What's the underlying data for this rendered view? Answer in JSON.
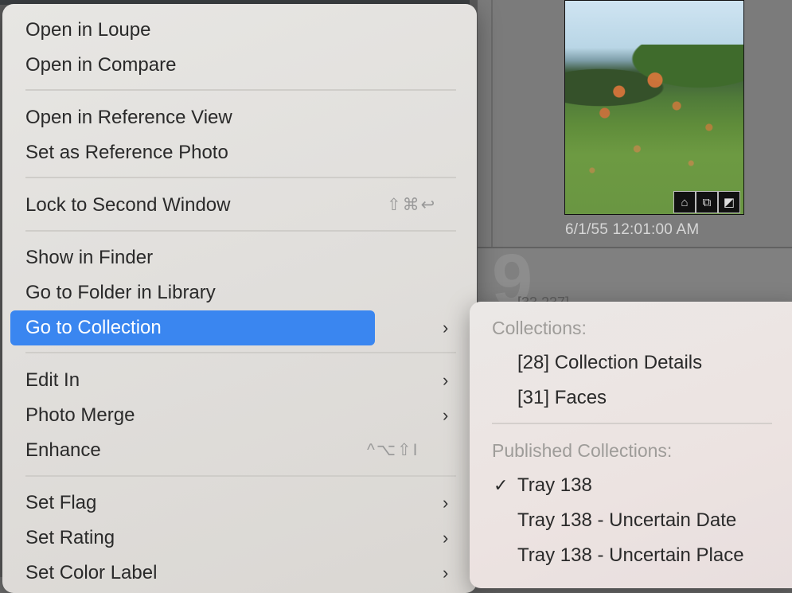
{
  "background": {
    "index_number": "9",
    "index_sub": "[33,237]",
    "photo_date": "6/1/55 12:01:00 AM",
    "badges": [
      "tag-icon",
      "stack-icon",
      "edit-icon"
    ]
  },
  "menu": {
    "groups": [
      {
        "items": [
          {
            "label": "Open in Loupe"
          },
          {
            "label": "Open in Compare"
          }
        ]
      },
      {
        "items": [
          {
            "label": "Open in Reference View"
          },
          {
            "label": "Set as Reference Photo"
          }
        ]
      },
      {
        "items": [
          {
            "label": "Lock to Second Window",
            "shortcut": "⇧⌘↩"
          }
        ]
      },
      {
        "items": [
          {
            "label": "Show in Finder"
          },
          {
            "label": "Go to Folder in Library"
          },
          {
            "label": "Go to Collection",
            "submenu": true,
            "highlighted": true
          }
        ]
      },
      {
        "items": [
          {
            "label": "Edit In",
            "submenu": true
          },
          {
            "label": "Photo Merge",
            "submenu": true
          },
          {
            "label": "Enhance",
            "shortcut": "^⌥⇧I"
          }
        ]
      },
      {
        "items": [
          {
            "label": "Set Flag",
            "submenu": true
          },
          {
            "label": "Set Rating",
            "submenu": true
          },
          {
            "label": "Set Color Label",
            "submenu": true
          }
        ]
      }
    ]
  },
  "submenu": {
    "collections_header": "Collections:",
    "collections": [
      "[28] Collection Details",
      "[31] Faces"
    ],
    "published_header": "Published Collections:",
    "published": [
      {
        "label": "Tray 138",
        "checked": true
      },
      {
        "label": "Tray 138 - Uncertain Date",
        "checked": false
      },
      {
        "label": "Tray 138 - Uncertain Place",
        "checked": false
      }
    ]
  }
}
